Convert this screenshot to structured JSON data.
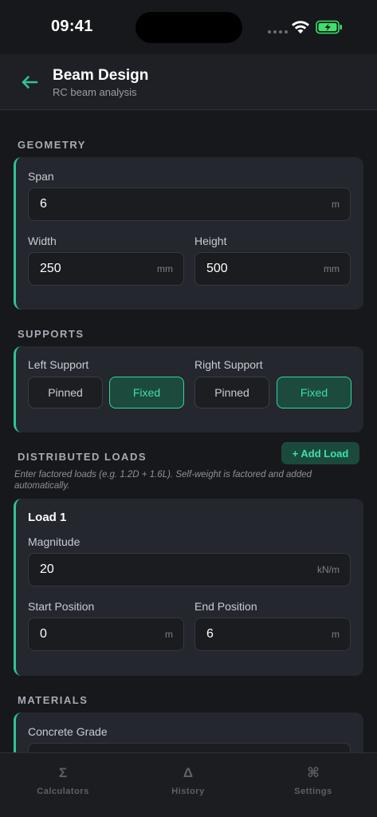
{
  "status_bar": {
    "time": "09:41"
  },
  "header": {
    "title": "Beam Design",
    "subtitle": "RC beam analysis"
  },
  "geometry": {
    "section_label": "GEOMETRY",
    "span": {
      "label": "Span",
      "value": "6",
      "unit": "m"
    },
    "width": {
      "label": "Width",
      "value": "250",
      "unit": "mm"
    },
    "height": {
      "label": "Height",
      "value": "500",
      "unit": "mm"
    }
  },
  "supports": {
    "section_label": "SUPPORTS",
    "left": {
      "label": "Left Support",
      "options": [
        "Pinned",
        "Fixed"
      ],
      "selected": "Fixed"
    },
    "right": {
      "label": "Right Support",
      "options": [
        "Pinned",
        "Fixed"
      ],
      "selected": "Fixed"
    }
  },
  "loads": {
    "section_label": "DISTRIBUTED LOADS",
    "add_label": "+ Add Load",
    "hint": "Enter factored loads (e.g. 1.2D + 1.6L). Self-weight is factored and added automatically.",
    "items": [
      {
        "title": "Load 1",
        "magnitude": {
          "label": "Magnitude",
          "value": "20",
          "unit": "kN/m"
        },
        "start": {
          "label": "Start Position",
          "value": "0",
          "unit": "m"
        },
        "end": {
          "label": "End Position",
          "value": "6",
          "unit": "m"
        }
      }
    ]
  },
  "materials": {
    "section_label": "MATERIALS",
    "concrete": {
      "label": "Concrete Grade"
    }
  },
  "tabs": [
    {
      "icon": "Σ",
      "label": "Calculators"
    },
    {
      "icon": "Δ",
      "label": "History"
    },
    {
      "icon": "⌘",
      "label": "Settings"
    }
  ],
  "colors": {
    "accent": "#2fc49a",
    "background": "#16181c",
    "card": "#24272d"
  }
}
